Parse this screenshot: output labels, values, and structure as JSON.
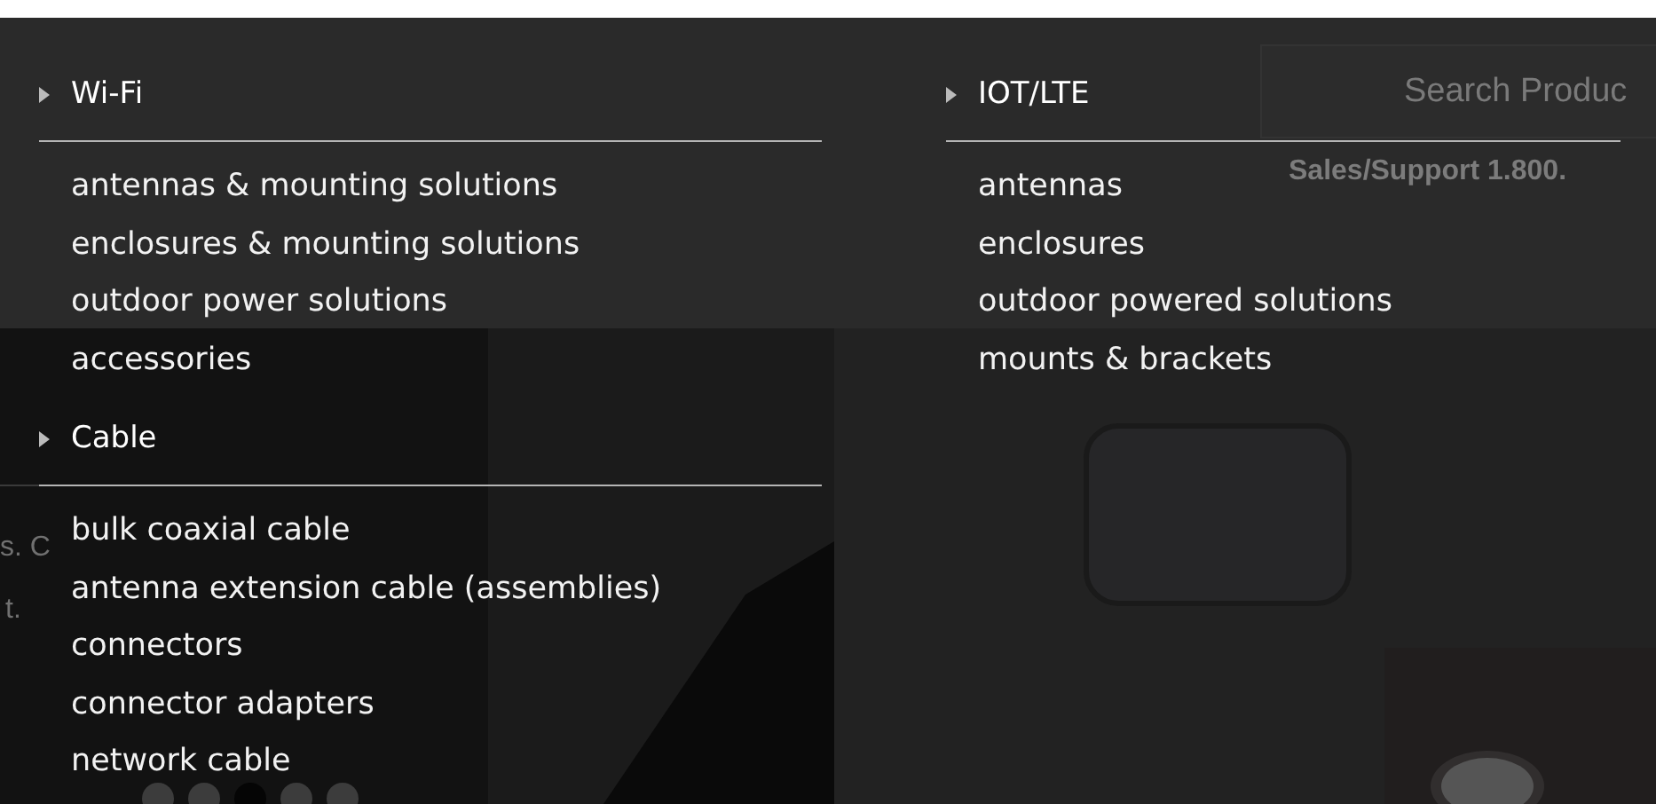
{
  "header": {
    "search": {
      "placeholder": "Search Produc"
    },
    "support": "Sales/Support 1.800."
  },
  "hero": {
    "kind": "picture",
    "text_fragments": [
      "s. C",
      "t."
    ],
    "slides": [
      {
        "selected": false
      },
      {
        "selected": false
      },
      {
        "selected": true
      },
      {
        "selected": false
      },
      {
        "selected": false
      }
    ]
  },
  "menu": {
    "columns": [
      {
        "groups": [
          {
            "title": "Wi-Fi",
            "items": [
              "antennas & mounting solutions",
              "enclosures & mounting solutions",
              "outdoor power solutions",
              "accessories"
            ]
          },
          {
            "title": "Cable",
            "items": [
              "bulk coaxial cable",
              "antenna extension cable (assemblies)",
              "connectors",
              "connector adapters",
              "network cable"
            ]
          }
        ]
      },
      {
        "groups": [
          {
            "title": "IOT/LTE",
            "items": [
              "antennas",
              "enclosures",
              "outdoor powered solutions",
              "mounts & brackets"
            ]
          }
        ]
      }
    ]
  }
}
